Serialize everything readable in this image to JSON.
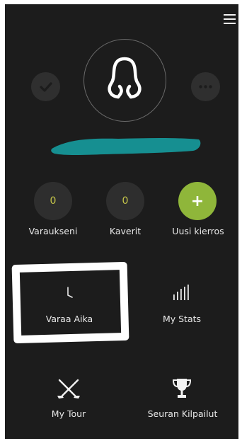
{
  "header": {
    "menu_icon": "hamburger-menu-icon"
  },
  "profile": {
    "avatar_icon": "user-silhouette-icon",
    "left_icon": "chat-check-icon",
    "right_icon": "chat-ellipsis-icon",
    "name_redaction_color": "#168f91"
  },
  "stats": [
    {
      "value": "0",
      "label": "Varaukseni"
    },
    {
      "value": "0",
      "label": "Kaverit"
    },
    {
      "value": "+",
      "label": "Uusi kierros"
    }
  ],
  "tiles": [
    {
      "label": "Varaa Aika",
      "icon": "clock-icon"
    },
    {
      "label": "My Stats",
      "icon": "bar-chart-icon"
    },
    {
      "label": "My Tour",
      "icon": "crossed-golf-clubs-icon"
    },
    {
      "label": "Seuran Kilpailut",
      "icon": "trophy-icon"
    }
  ],
  "colors": {
    "background": "#1c1c1c",
    "accent_green": "#8fb63a",
    "counter_yellow": "#c7c74a",
    "circle_gray": "#2e2e2e"
  }
}
